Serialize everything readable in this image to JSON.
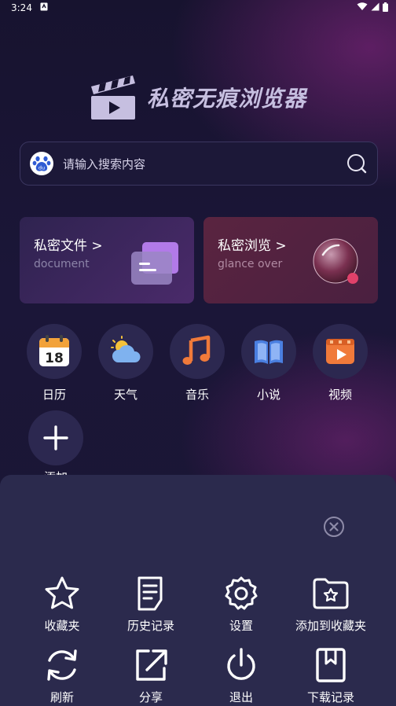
{
  "status_bar": {
    "time": "3:24"
  },
  "app": {
    "title": "私密无痕浏览器"
  },
  "search": {
    "placeholder": "请输入搜索内容",
    "engine_icon_text": "du"
  },
  "cards": [
    {
      "title": "私密文件 >",
      "subtitle": "document"
    },
    {
      "title": "私密浏览 >",
      "subtitle": "glance over"
    }
  ],
  "apps": [
    {
      "label": "日历",
      "icon": "calendar-icon",
      "day": "18"
    },
    {
      "label": "天气",
      "icon": "weather-icon"
    },
    {
      "label": "音乐",
      "icon": "music-icon"
    },
    {
      "label": "小说",
      "icon": "book-icon"
    },
    {
      "label": "视频",
      "icon": "video-icon"
    }
  ],
  "add_app": {
    "label": "添加"
  },
  "menu": {
    "row1": [
      {
        "label": "收藏夹",
        "icon": "star-icon"
      },
      {
        "label": "历史记录",
        "icon": "history-icon"
      },
      {
        "label": "设置",
        "icon": "settings-icon"
      },
      {
        "label": "添加到收藏夹",
        "icon": "add-favorite-icon"
      }
    ],
    "row2": [
      {
        "label": "刷新",
        "icon": "refresh-icon"
      },
      {
        "label": "分享",
        "icon": "share-icon"
      },
      {
        "label": "退出",
        "icon": "power-icon"
      },
      {
        "label": "下载记录",
        "icon": "download-record-icon"
      }
    ]
  },
  "colors": {
    "background": "#1b1638",
    "sheet": "#2b2a4d",
    "accent_purple": "#b27ae8",
    "accent_pink": "#e0416a"
  }
}
